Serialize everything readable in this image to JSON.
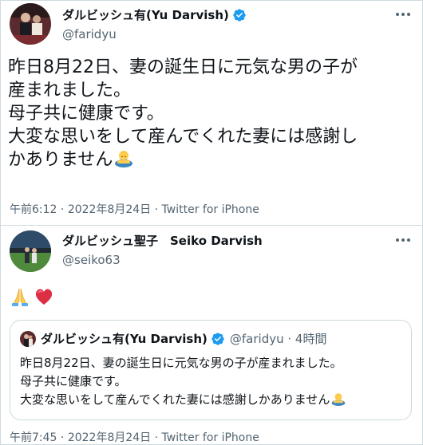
{
  "tweet1": {
    "display_name": "ダルビッシュ有(Yu Darvish)",
    "handle": "@faridyu",
    "lines": [
      "昨日8月22日、妻の誕生日に元気な男の子が",
      "産まれました。",
      "母子共に健康です。",
      "大変な思いをして産んでくれた妻には感謝し",
      "かありません"
    ],
    "emoji": "person-bowing-emoji",
    "time": "午前6:12",
    "date": "2022年8月24日",
    "source": "Twitter for iPhone",
    "separator": " · "
  },
  "tweet2": {
    "display_name": "ダルビッシュ聖子　Seiko Darvish",
    "handle": "@seiko63",
    "emojis": [
      "folded-hands-emoji",
      "heart-emoji"
    ],
    "quote": {
      "display_name": "ダルビッシュ有(Yu Darvish)",
      "handle_time": "@faridyu · 4時間",
      "lines": [
        "昨日8月22日、妻の誕生日に元気な男の子が産まれました。",
        "母子共に健康です。",
        "大変な思いをして産んでくれた妻には感謝しかありません"
      ]
    },
    "time": "午前7:45",
    "date": "2022年8月24日",
    "source": "Twitter for iPhone",
    "separator": " · "
  },
  "colors": {
    "text": "#0f1419",
    "secondary": "#536471",
    "verified": "#1d9bf0",
    "border": "#cfd9de"
  }
}
